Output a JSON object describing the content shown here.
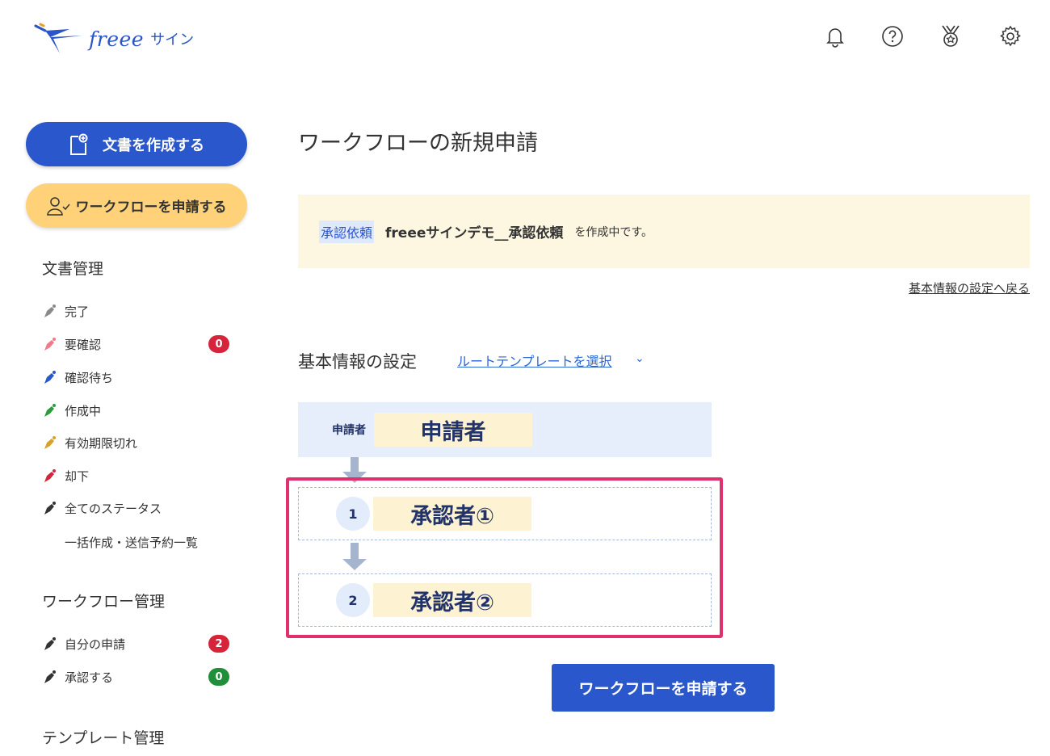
{
  "header": {
    "logo_text": "freee",
    "logo_sub": "サイン",
    "icons": [
      "bell-icon",
      "help-icon",
      "medal-icon",
      "settings-icon"
    ]
  },
  "sidebar": {
    "create_button": "文書を作成する",
    "workflow_button": "ワークフローを申請する",
    "doc_section": "文書管理",
    "doc_items": [
      {
        "label": "完了",
        "color": "#8a8a8a"
      },
      {
        "label": "要確認",
        "color": "#f07a86",
        "badge": "0",
        "badge_color": "#d6243a"
      },
      {
        "label": "確認待ち",
        "color": "#2b57cc"
      },
      {
        "label": "作成中",
        "color": "#2e9a3c"
      },
      {
        "label": "有効期限切れ",
        "color": "#d8a12c"
      },
      {
        "label": "却下",
        "color": "#d6243a"
      },
      {
        "label": "全てのステータス",
        "color": "#333333"
      }
    ],
    "batch_item": "一括作成・送信予約一覧",
    "wf_section": "ワークフロー管理",
    "wf_items": [
      {
        "label": "自分の申請",
        "badge": "2",
        "badge_color": "#d6243a"
      },
      {
        "label": "承認する",
        "badge": "0",
        "badge_color": "#1f8f3a"
      }
    ],
    "tpl_section": "テンプレート管理"
  },
  "main": {
    "title": "ワークフローの新規申請",
    "notice_tag": "承認依頼",
    "notice_doc": "freeeサインデモ__承認依頼",
    "notice_tail": "を作成中です。",
    "back_link": "基本情報の設定へ戻る",
    "subtitle": "基本情報の設定",
    "template_link": "ルートテンプレートを選択",
    "chevron": "⌄",
    "applicant_label": "申請者",
    "applicant_name": "申請者",
    "steps": [
      {
        "num": "1",
        "name": "承認者①"
      },
      {
        "num": "2",
        "name": "承認者②"
      }
    ],
    "submit": "ワークフローを申請する"
  },
  "colors": {
    "primary": "#2b57cc",
    "highlight_border": "#e0306d",
    "notice_bg": "#fdf6e1",
    "workflow_button": "#ffd27a"
  }
}
